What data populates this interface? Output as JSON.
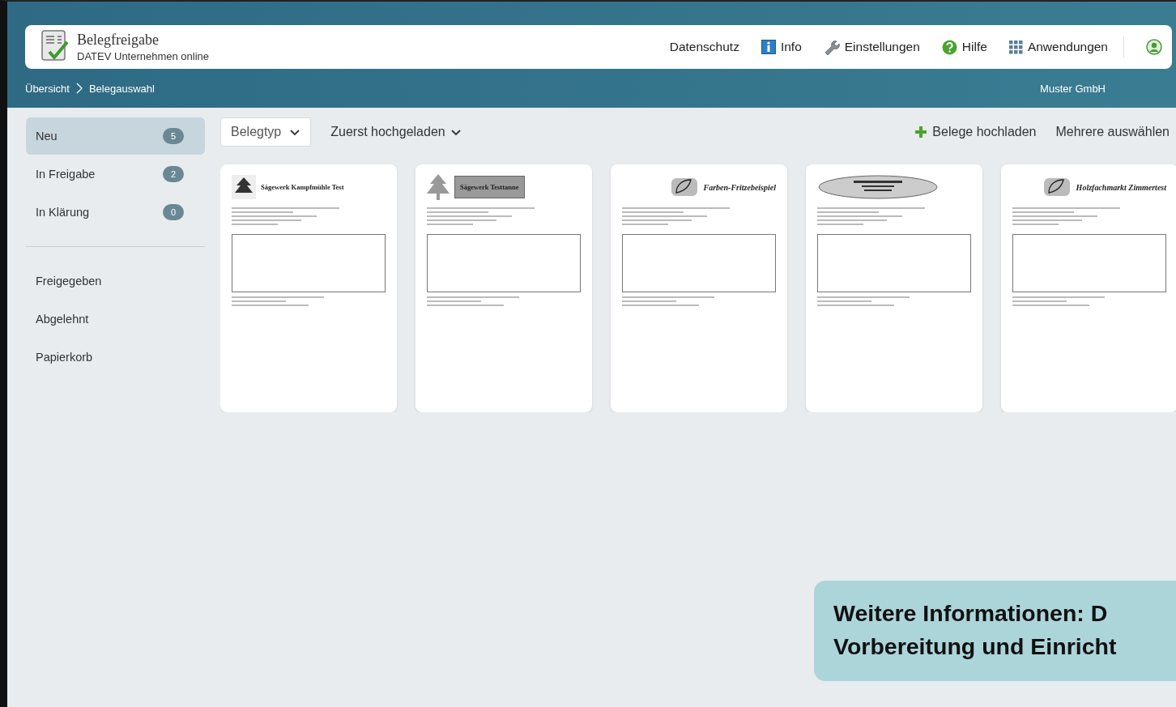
{
  "app": {
    "title": "Belegfreigabe",
    "subtitle": "DATEV Unternehmen online"
  },
  "top_nav": [
    {
      "label": "Datenschutz",
      "kind": "text"
    },
    {
      "label": "Info",
      "kind": "info"
    },
    {
      "label": "Einstellungen",
      "kind": "wrench"
    },
    {
      "label": "Hilfe",
      "kind": "help"
    },
    {
      "label": "Anwendungen",
      "kind": "apps"
    }
  ],
  "breadcrumb": [
    "Übersicht",
    "Belegauswahl"
  ],
  "company": "Muster GmbH",
  "sidebar": {
    "status_items": [
      {
        "label": "Neu",
        "count": "5",
        "selected": true
      },
      {
        "label": "In Freigabe",
        "count": "2",
        "selected": false
      },
      {
        "label": "In Klärung",
        "count": "0",
        "selected": false
      }
    ],
    "archive_items": [
      {
        "label": "Freigegeben",
        "selected": false
      },
      {
        "label": "Abgelehnt",
        "selected": false
      },
      {
        "label": "Papierkorb",
        "selected": false
      }
    ]
  },
  "toolbar": {
    "type_filter": "Belegtyp",
    "sort": "Zuerst hochgeladen",
    "upload": "Belege hochladen",
    "multi_select": "Mehrere auswählen"
  },
  "documents": [
    {
      "heading": "Sägewerk Kampfmühle Test",
      "kind": "left"
    },
    {
      "heading": "Sägewerk Testtanne",
      "kind": "banner"
    },
    {
      "heading": "Farben-Fritzebeispiel",
      "kind": "right"
    },
    {
      "kind": "oval"
    },
    {
      "heading": "Holzfachmarkt Zimmertest",
      "kind": "right"
    }
  ],
  "callout": {
    "lines": [
      "Weitere Informationen: D",
      "Vorbereitung und Einricht"
    ]
  }
}
